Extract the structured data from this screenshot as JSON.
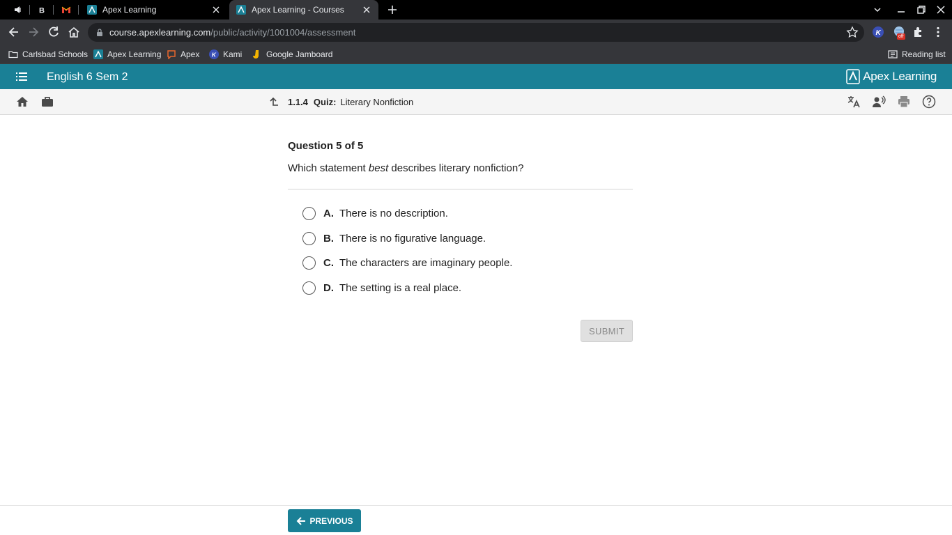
{
  "browser": {
    "pinned_tabs": [
      "mute-icon",
      "b-icon",
      "gmail-icon"
    ],
    "tabs": [
      {
        "title": "Apex Learning",
        "active": false
      },
      {
        "title": "Apex Learning - Courses",
        "active": true
      }
    ],
    "url_host": "course.apexlearning.com",
    "url_path": "/public/activity/1001004/assessment",
    "extension_badge": "off",
    "bookmarks": [
      {
        "label": "Carlsbad Schools",
        "icon": "folder-icon"
      },
      {
        "label": "Apex Learning",
        "icon": "apex-icon"
      },
      {
        "label": "Apex",
        "icon": "chat-icon"
      },
      {
        "label": "Kami",
        "icon": "kami-icon"
      },
      {
        "label": "Google Jamboard",
        "icon": "jamboard-icon"
      }
    ],
    "reading_list": "Reading list"
  },
  "app": {
    "course_title": "English 6 Sem 2",
    "brand": "Apex Learning",
    "activity_number": "1.1.4",
    "activity_type": "Quiz:",
    "activity_title": "Literary Nonfiction",
    "accent": "#1a8096"
  },
  "question": {
    "header": "Question 5 of 5",
    "text_before": "Which statement ",
    "text_emphasis": "best",
    "text_after": " describes literary nonfiction?",
    "options": [
      {
        "letter": "A.",
        "text": "There is no description."
      },
      {
        "letter": "B.",
        "text": "There is no figurative language."
      },
      {
        "letter": "C.",
        "text": "The characters are imaginary people."
      },
      {
        "letter": "D.",
        "text": "The setting is a real place."
      }
    ],
    "submit_label": "SUBMIT"
  },
  "footer": {
    "previous_label": "PREVIOUS"
  }
}
